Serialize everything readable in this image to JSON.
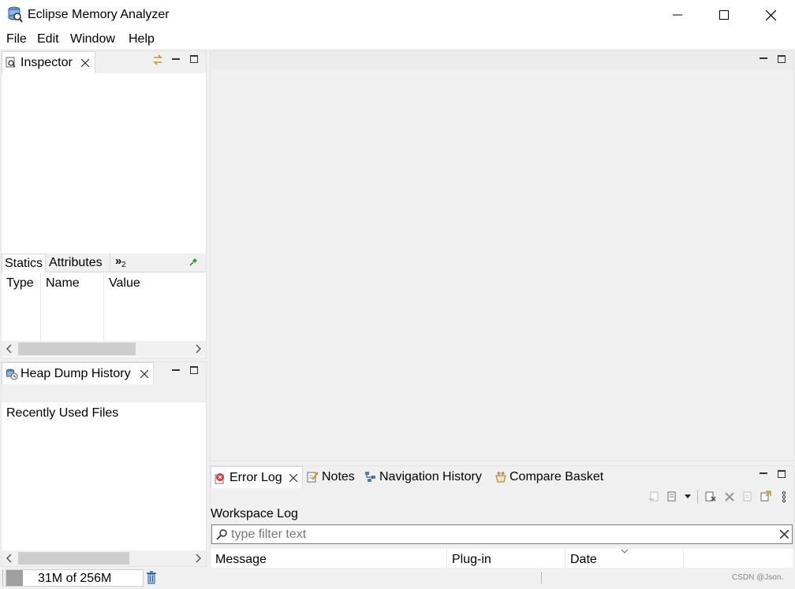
{
  "window": {
    "title": "Eclipse Memory Analyzer",
    "controls": [
      "minimize",
      "maximize",
      "close"
    ]
  },
  "menu": {
    "items": [
      "File",
      "Edit",
      "Window",
      "Help"
    ]
  },
  "inspector": {
    "tab_label": "Inspector",
    "subtabs": [
      "Statics",
      "Attributes"
    ],
    "overflow_label": "»",
    "overflow_count": "2",
    "columns": [
      "Type",
      "Name",
      "Value"
    ]
  },
  "heap_history": {
    "tab_label": "Heap Dump History",
    "section_label": "Recently Used Files"
  },
  "bottom_panel": {
    "tabs": [
      "Error Log",
      "Notes",
      "Navigation History",
      "Compare Basket"
    ],
    "workspace_label": "Workspace Log",
    "filter_placeholder": "type filter text",
    "columns": [
      "Message",
      "Plug-in",
      "Date"
    ]
  },
  "status": {
    "heap_text": "31M of 256M",
    "heap_used_fraction": 0.12
  },
  "watermark": "CSDN @Json."
}
